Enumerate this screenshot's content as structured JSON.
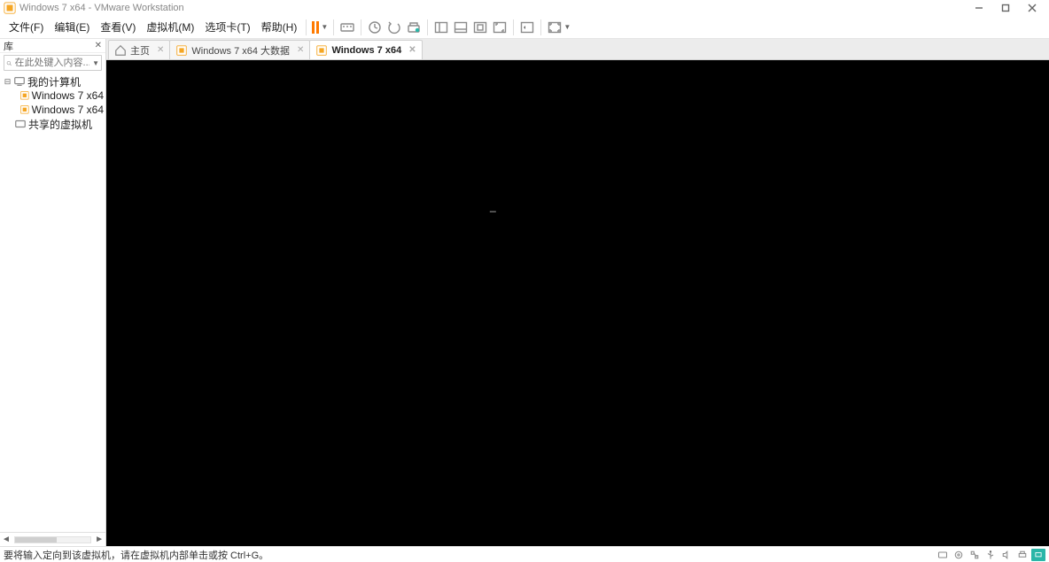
{
  "window": {
    "title": "Windows 7 x64 - VMware Workstation"
  },
  "menu": {
    "file": "文件(F)",
    "edit": "编辑(E)",
    "view": "查看(V)",
    "vm": "虚拟机(M)",
    "tabs": "选项卡(T)",
    "help": "帮助(H)"
  },
  "sidebar": {
    "header": "库",
    "search_placeholder": "在此处键入内容...",
    "root": "我的计算机",
    "vm1": "Windows 7 x64",
    "vm2": "Windows 7 x64",
    "shared": "共享的虚拟机"
  },
  "tabs": {
    "home": "主页",
    "t1": "Windows 7 x64 大数据",
    "t2": "Windows 7 x64"
  },
  "status": {
    "message": "要将输入定向到该虚拟机，请在虚拟机内部单击或按 Ctrl+G。"
  }
}
